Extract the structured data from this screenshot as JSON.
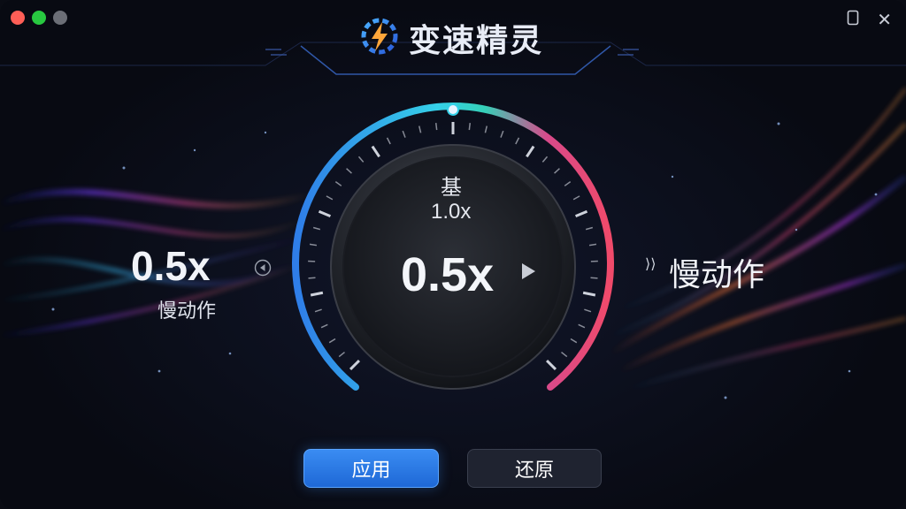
{
  "app": {
    "title": "变速精灵",
    "logo_icon": "lightning-gear-icon"
  },
  "window_controls": {
    "close_color": "#ff5f57",
    "minimize_color": "#28c840",
    "zoom_color": "#6b6e76",
    "restore_icon": "window-restore-icon",
    "close_icon": "close-icon",
    "close_glyph": "✕"
  },
  "speed": {
    "current_value": "0.5x",
    "current_label": "慢动作",
    "base_label": "基",
    "base_value": "1.0x",
    "center_value": "0.5x",
    "right_mode_label": "慢动作",
    "right_arrow": "⟩⟩",
    "dial_level": 0.5
  },
  "buttons": {
    "apply": "应用",
    "reset": "还原"
  },
  "colors": {
    "accent_blue": "#2f7de8",
    "arc_cyan": "#35d0b8",
    "arc_red": "#f04a6a"
  }
}
